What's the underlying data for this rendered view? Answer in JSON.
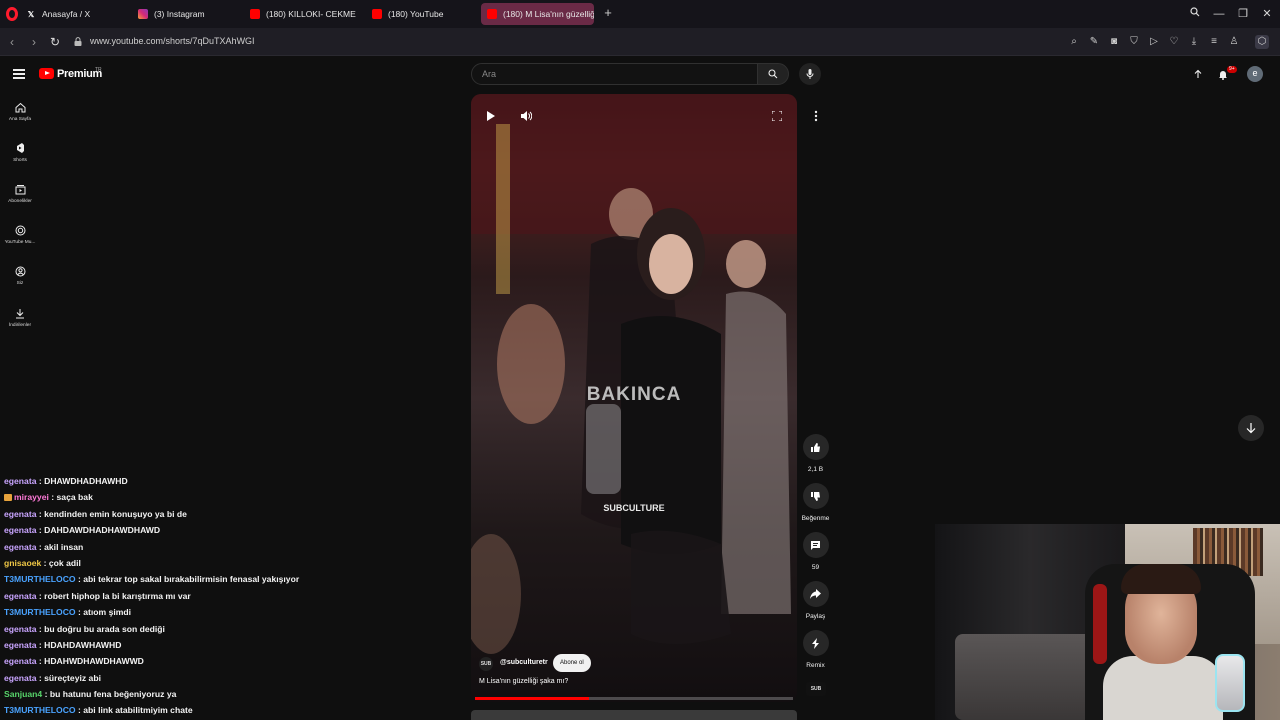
{
  "browser": {
    "tabs": [
      {
        "title": "Anasayfa / X",
        "favicon": "x-logo"
      },
      {
        "title": "(3) Instagram",
        "favicon": "instagram-logo"
      },
      {
        "title": "(180) KILLOKI- CEKMEKOY",
        "favicon": "youtube-logo"
      },
      {
        "title": "(180) YouTube",
        "favicon": "youtube-logo"
      },
      {
        "title": "(180) M Lisa'nın güzelliği",
        "favicon": "youtube-logo",
        "active": true
      }
    ],
    "url": "www.youtube.com/shorts/7qDuTXAhWGI"
  },
  "youtube": {
    "brand": "Premium",
    "country": "TR",
    "search_placeholder": "Ara",
    "notification_count": "9+",
    "avatar_letter": "e",
    "guide": [
      {
        "label": "Ana Sayfa",
        "icon": "home-icon"
      },
      {
        "label": "Shorts",
        "icon": "shorts-icon"
      },
      {
        "label": "Abonelikler",
        "icon": "subscriptions-icon"
      },
      {
        "label": "YouTube Mu...",
        "icon": "youtube-music-icon"
      },
      {
        "label": "Siz",
        "icon": "you-icon"
      },
      {
        "label": "İndirilenler",
        "icon": "download-icon"
      }
    ]
  },
  "short": {
    "caption_overlay": "BAKINCA",
    "watermark": "SUBCULTURE",
    "channel_logo": "SUB",
    "channel_handle": "@subculturetr",
    "subscribe_label": "Abone ol",
    "title": "M Lisa'nın güzelliği şaka mı?",
    "progress": 0.36,
    "actions": {
      "likes": "2,1 B",
      "dislike_label": "Beğenme",
      "comments": "59",
      "share_label": "Paylaş",
      "remix_label": "Remix"
    },
    "channel_thumb": "SUB"
  },
  "chat": [
    {
      "user": "egenata",
      "color": "#c9a5ff",
      "text": "DHAWDHADHAWHD"
    },
    {
      "user": "mirayyei",
      "color": "#ff7ad9",
      "text": "saça bak",
      "badge": true
    },
    {
      "user": "egenata",
      "color": "#c9a5ff",
      "text": "kendinden emin konuşuyo ya bi de"
    },
    {
      "user": "egenata",
      "color": "#c9a5ff",
      "text": "DAHDAWDHADHAWDHAWD"
    },
    {
      "user": "egenata",
      "color": "#c9a5ff",
      "text": "akil insan"
    },
    {
      "user": "gnisaoek",
      "color": "#f0c846",
      "text": "çok adil"
    },
    {
      "user": "T3MURTHELOCO",
      "color": "#4aa3ff",
      "text": "abi tekrar top sakal bırakabilirmisin fenasal yakışıyor"
    },
    {
      "user": "egenata",
      "color": "#c9a5ff",
      "text": "robert hiphop la bi karıştırma mı var"
    },
    {
      "user": "T3MURTHELOCO",
      "color": "#4aa3ff",
      "text": "atıom şimdi"
    },
    {
      "user": "egenata",
      "color": "#c9a5ff",
      "text": "bu doğru bu arada son dediği"
    },
    {
      "user": "egenata",
      "color": "#c9a5ff",
      "text": "HDAHDAWHAWHD"
    },
    {
      "user": "egenata",
      "color": "#c9a5ff",
      "text": "HDAHWDHAWDHAWWD"
    },
    {
      "user": "egenata",
      "color": "#c9a5ff",
      "text": "süreçteyiz abi"
    },
    {
      "user": "Sanjuan4",
      "color": "#57d36a",
      "text": "bu hatunu fena beğeniyoruz ya"
    },
    {
      "user": "T3MURTHELOCO",
      "color": "#4aa3ff",
      "text": "abi link atabilitmiyim chate"
    }
  ]
}
